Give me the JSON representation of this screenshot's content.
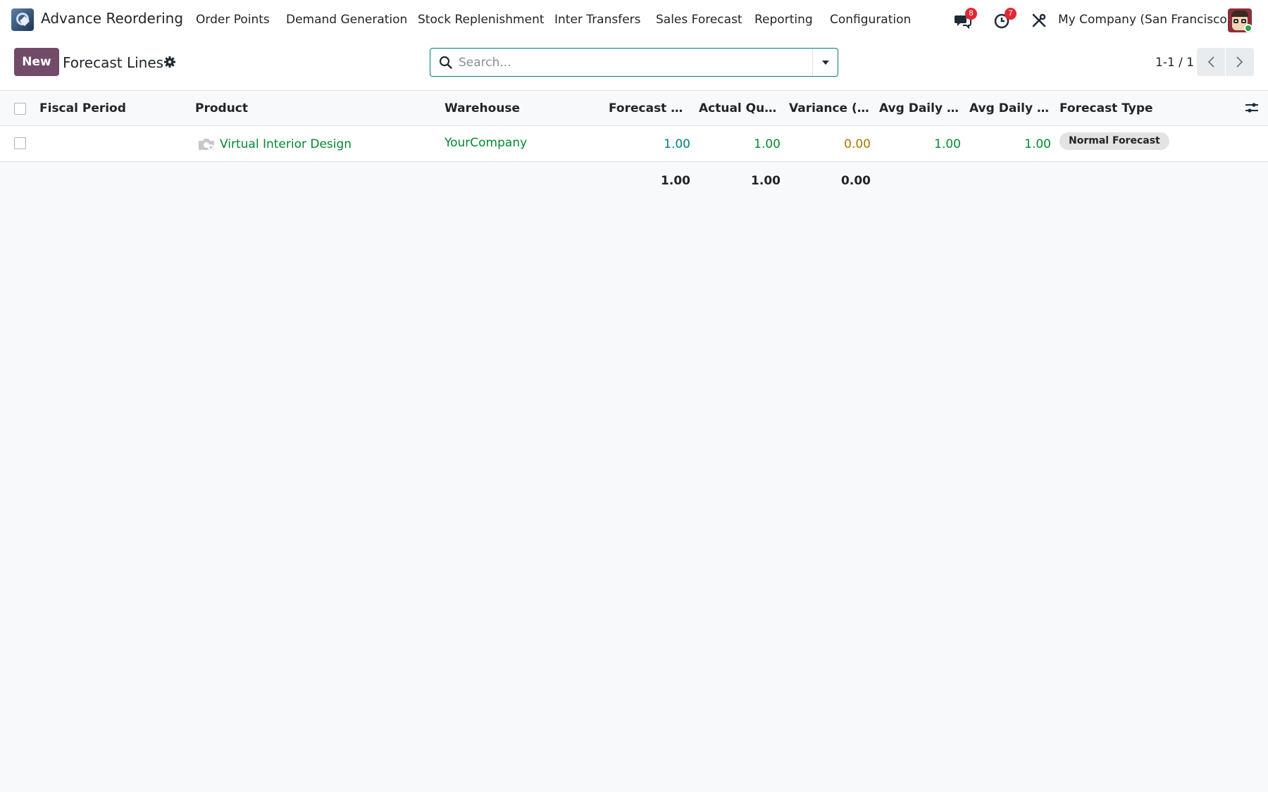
{
  "navbar": {
    "app_name": "Advance Reordering",
    "menu": [
      "Order Points",
      "Demand Generation",
      "Stock Replenishment",
      "Inter Transfers",
      "Sales Forecast",
      "Reporting",
      "Configuration"
    ],
    "messages_count": "8",
    "activities_count": "7",
    "company": "My Company (San Francisco)"
  },
  "control": {
    "new_label": "New",
    "title": "Forecast Lines",
    "search_placeholder": "Search...",
    "pager": "1-1 / 1"
  },
  "table": {
    "columns": [
      "Fiscal Period",
      "Product",
      "Warehouse",
      "Forecast Qu...",
      "Actual Qua...",
      "Variance (A...",
      "Avg Daily F...",
      "Avg Daily A...",
      "Forecast Type"
    ],
    "rows": [
      {
        "fiscal_period": "",
        "product": "Virtual Interior Design",
        "warehouse": "YourCompany",
        "forecast_qty": "1.00",
        "actual_qty": "1.00",
        "variance": "0.00",
        "avg_daily_forecast": "1.00",
        "avg_daily_actual": "1.00",
        "forecast_type": "Normal Forecast"
      }
    ],
    "totals": {
      "forecast_qty": "1.00",
      "actual_qty": "1.00",
      "variance": "0.00"
    }
  },
  "colors": {
    "brand": "#714b67",
    "link_green": "#018a2d",
    "forecast_blue": "#017e84",
    "variance_amber": "#a87600",
    "badge_red": "#e02835"
  }
}
